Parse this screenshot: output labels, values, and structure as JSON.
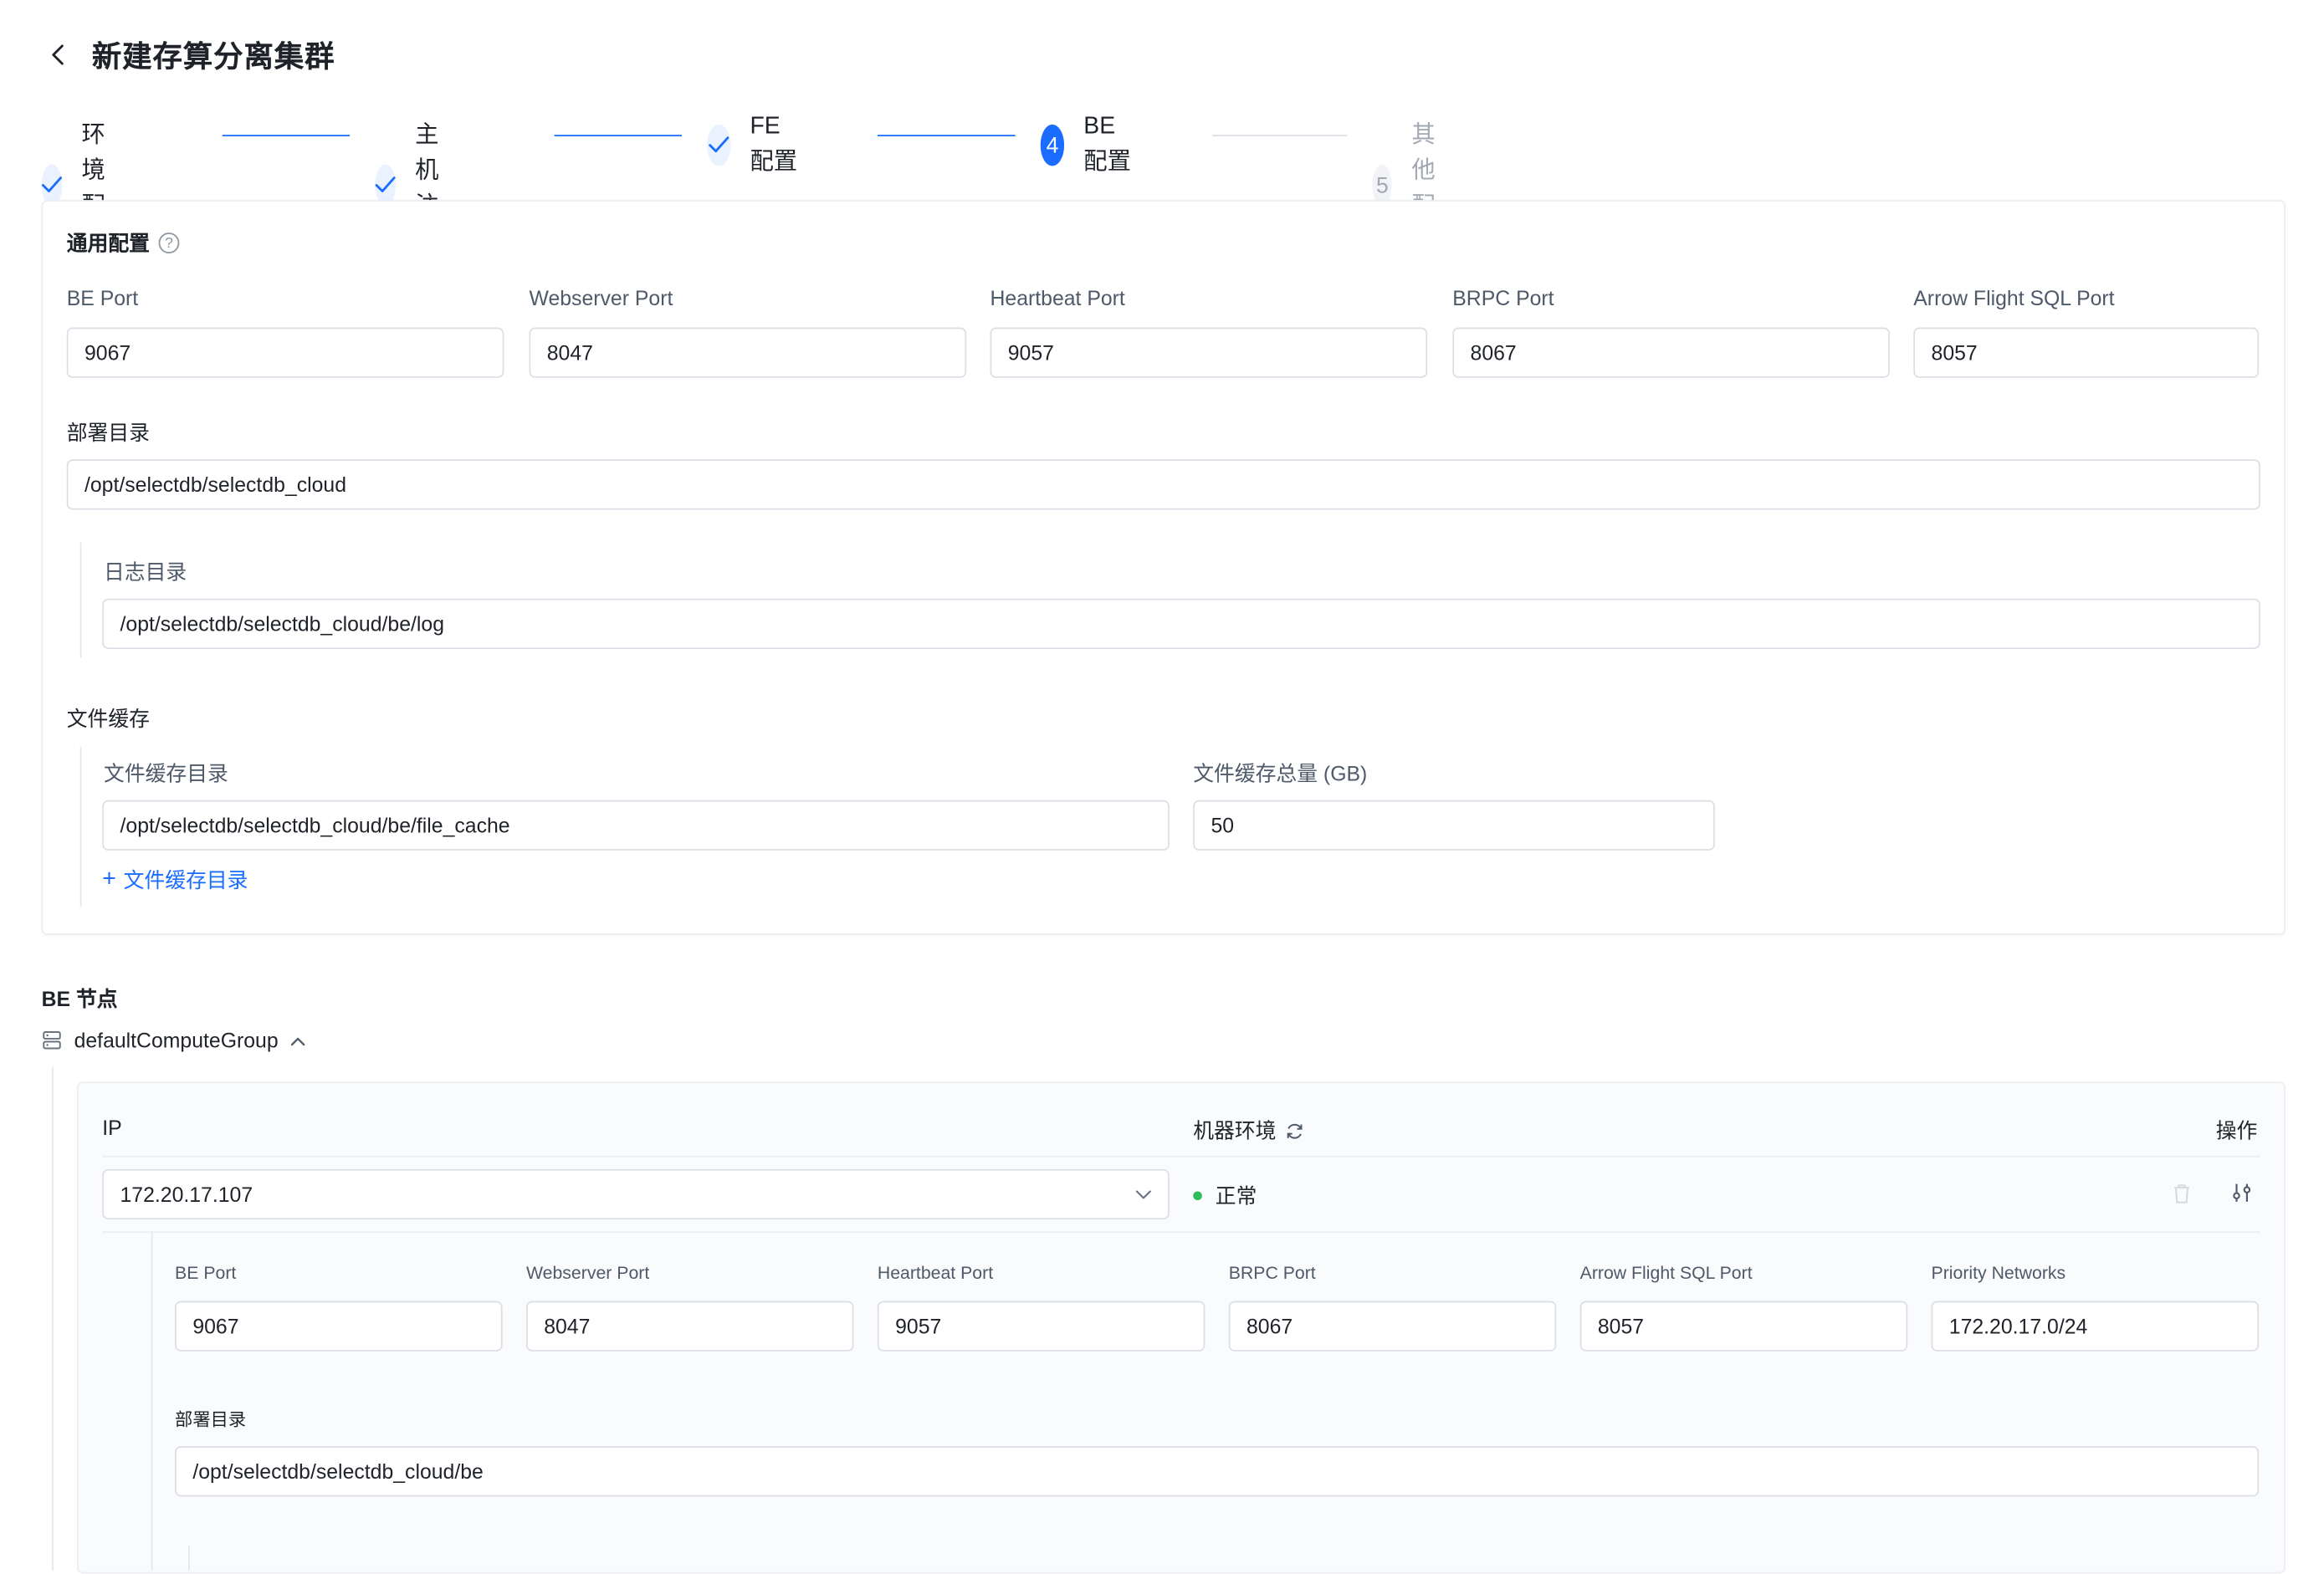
{
  "page": {
    "title": "新建存算分离集群"
  },
  "steps": [
    {
      "num": "1",
      "label": "环境配置",
      "state": "done"
    },
    {
      "num": "2",
      "label": "主机注册",
      "state": "done"
    },
    {
      "num": "3",
      "label": "FE 配置",
      "state": "done"
    },
    {
      "num": "4",
      "label": "BE 配置",
      "state": "active"
    },
    {
      "num": "5",
      "label": "其他配置",
      "state": "todo"
    }
  ],
  "general": {
    "title": "通用配置",
    "ports": [
      {
        "label": "BE Port",
        "value": "9067"
      },
      {
        "label": "Webserver Port",
        "value": "8047"
      },
      {
        "label": "Heartbeat Port",
        "value": "9057"
      },
      {
        "label": "BRPC Port",
        "value": "8067"
      },
      {
        "label": "Arrow Flight SQL Port",
        "value": "8057"
      }
    ],
    "deploy_dir_label": "部署目录",
    "deploy_dir_value": "/opt/selectdb/selectdb_cloud",
    "log_dir_label": "日志目录",
    "log_dir_value": "/opt/selectdb/selectdb_cloud/be/log",
    "file_cache_title": "文件缓存",
    "file_cache_dir_label": "文件缓存目录",
    "file_cache_dir_value": "/opt/selectdb/selectdb_cloud/be/file_cache",
    "file_cache_size_label": "文件缓存总量 (GB)",
    "file_cache_size_value": "50",
    "add_cache_dir_label": "文件缓存目录"
  },
  "nodes": {
    "title": "BE 节点",
    "group_name": "defaultComputeGroup",
    "col_ip": "IP",
    "col_env": "机器环境",
    "col_ops": "操作",
    "row": {
      "ip": "172.20.17.107",
      "status": "正常",
      "ports": [
        {
          "label": "BE Port",
          "value": "9067"
        },
        {
          "label": "Webserver Port",
          "value": "8047"
        },
        {
          "label": "Heartbeat Port",
          "value": "9057"
        },
        {
          "label": "BRPC Port",
          "value": "8067"
        },
        {
          "label": "Arrow Flight SQL Port",
          "value": "8057"
        },
        {
          "label": "Priority Networks",
          "value": "172.20.17.0/24"
        }
      ],
      "deploy_dir_label": "部署目录",
      "deploy_dir_value": "/opt/selectdb/selectdb_cloud/be"
    }
  },
  "colors": {
    "primary": "#1a6dff",
    "success": "#2dbd5a"
  }
}
